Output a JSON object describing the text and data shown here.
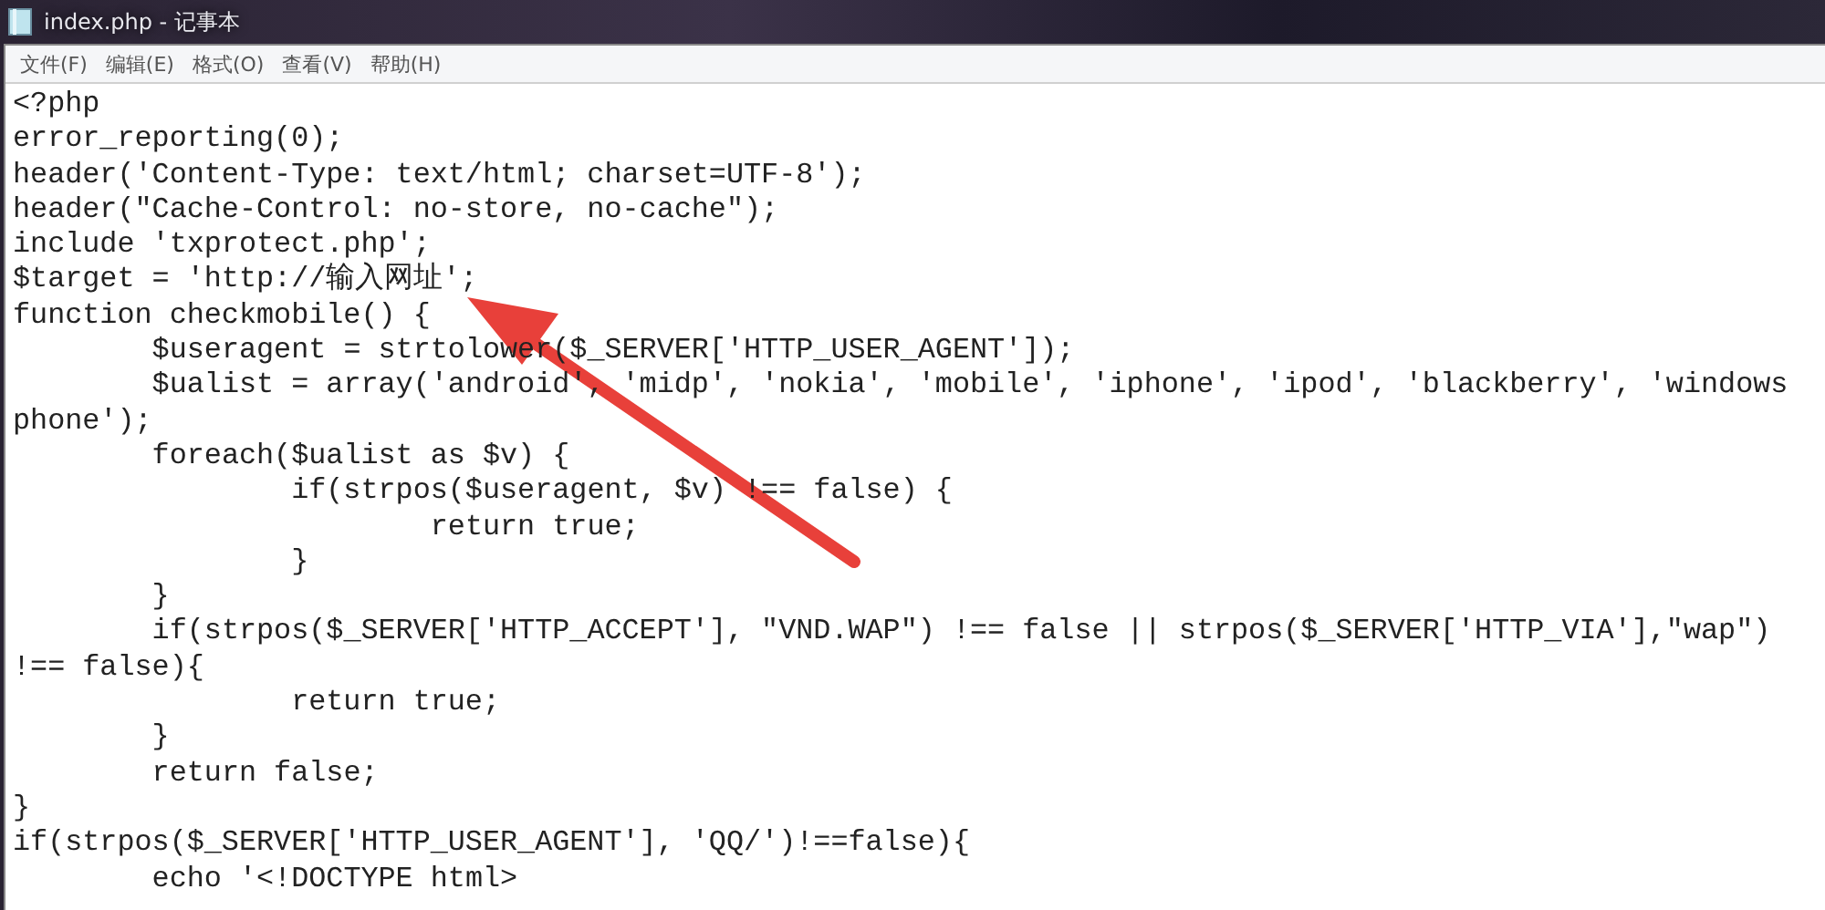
{
  "window": {
    "title": "index.php - 记事本"
  },
  "menu": [
    "文件(F)",
    "编辑(E)",
    "格式(O)",
    "查看(V)",
    "帮助(H)"
  ],
  "editor": {
    "lines": [
      "<?php",
      "error_reporting(0);",
      "header('Content-Type: text/html; charset=UTF-8');",
      "header(\"Cache-Control: no-store, no-cache\");",
      "include 'txprotect.php';",
      "$target = 'http://输入网址';",
      "function checkmobile() {",
      "\t$useragent = strtolower($_SERVER['HTTP_USER_AGENT']);",
      "\t$ualist = array('android', 'midp', 'nokia', 'mobile', 'iphone', 'ipod', 'blackberry', 'windows",
      "phone');",
      "\tforeach($ualist as $v) {",
      "\t\tif(strpos($useragent, $v) !== false) {",
      "\t\t\treturn true;",
      "\t\t}",
      "\t}",
      "\tif(strpos($_SERVER['HTTP_ACCEPT'], \"VND.WAP\") !== false || strpos($_SERVER['HTTP_VIA'],\"wap\")",
      "!== false){",
      "\t\treturn true;",
      "\t}",
      "\treturn false;",
      "}",
      "if(strpos($_SERVER['HTTP_USER_AGENT'], 'QQ/')!==false){",
      "\techo '<!DOCTYPE html>"
    ]
  }
}
